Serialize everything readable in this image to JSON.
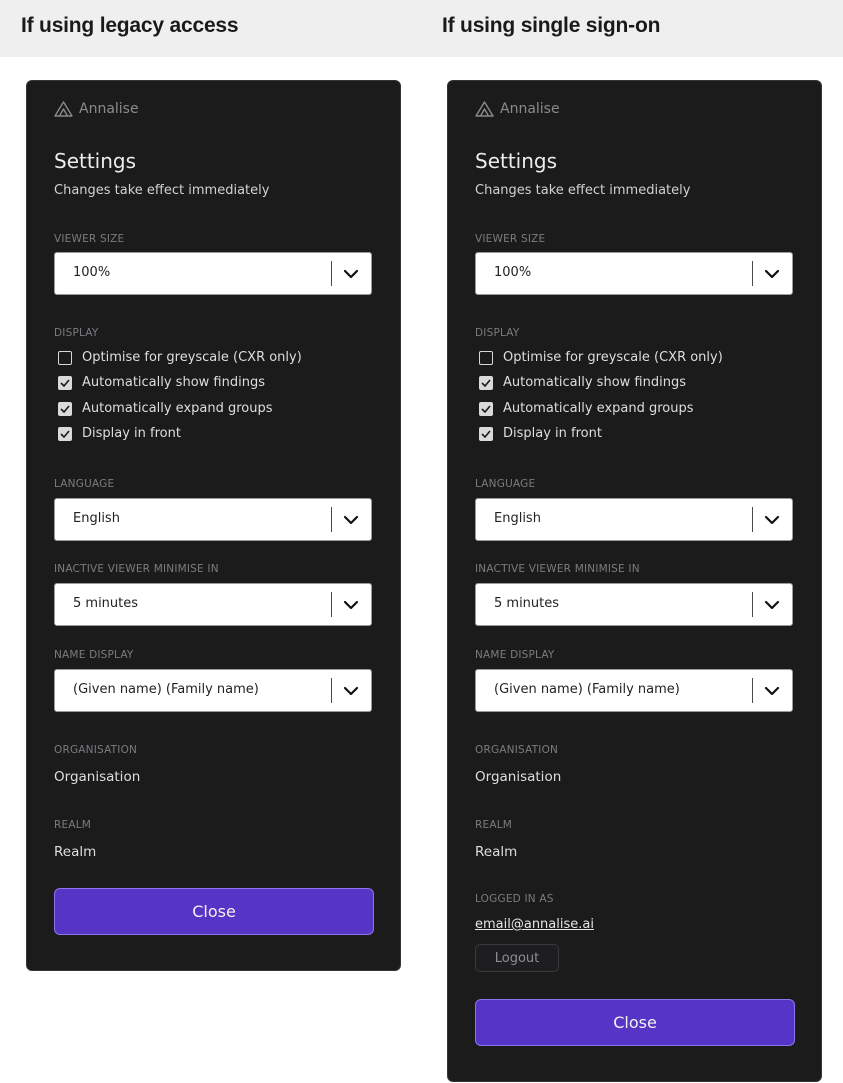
{
  "headings": {
    "left": "If using legacy access",
    "right": "If using single sign-on"
  },
  "panel": {
    "brand_icon": "annalise-logo-icon",
    "brand": "Annalise",
    "title": "Settings",
    "subtitle": "Changes take effect immediately",
    "viewer_size": {
      "label": "VIEWER SIZE",
      "value": "100%"
    },
    "display": {
      "label": "DISPLAY",
      "options": [
        {
          "label": "Optimise for greyscale (CXR only)",
          "checked": false
        },
        {
          "label": "Automatically show findings",
          "checked": true
        },
        {
          "label": "Automatically expand groups",
          "checked": true
        },
        {
          "label": "Display in front",
          "checked": true
        }
      ]
    },
    "language": {
      "label": "LANGUAGE",
      "value": "English"
    },
    "inactive": {
      "label": "INACTIVE VIEWER MINIMISE IN",
      "value": "5 minutes"
    },
    "name_display": {
      "label": "NAME DISPLAY",
      "value": "(Given name) (Family name)"
    },
    "organisation": {
      "label": "ORGANISATION",
      "value": "Organisation"
    },
    "realm": {
      "label": "REALM",
      "value": "Realm"
    },
    "logged_in": {
      "label": "LOGGED IN AS",
      "email": "email@annalise.ai",
      "logout": "Logout"
    },
    "close": "Close"
  },
  "colors": {
    "panel_bg": "#1b1b1c",
    "accent": "#5635c6",
    "header_bg": "#efefef"
  }
}
